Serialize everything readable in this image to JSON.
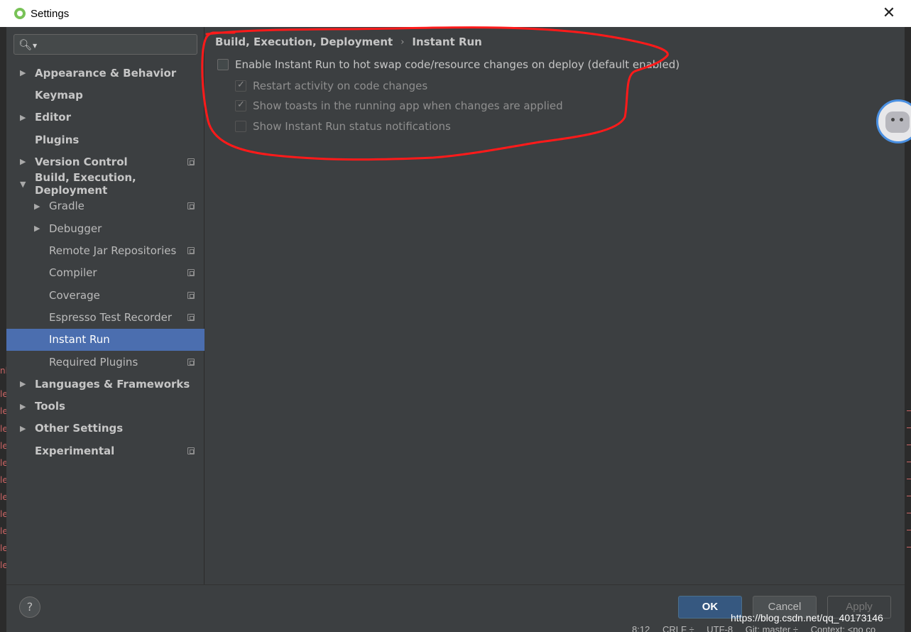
{
  "window": {
    "title": "Settings"
  },
  "search": {
    "placeholder": ""
  },
  "sidebar": {
    "items": [
      {
        "label": "Appearance & Behavior",
        "arrow": "▶"
      },
      {
        "label": "Keymap"
      },
      {
        "label": "Editor",
        "arrow": "▶"
      },
      {
        "label": "Plugins"
      },
      {
        "label": "Version Control",
        "arrow": "▶"
      },
      {
        "label": "Build, Execution, Deployment",
        "arrow": "▼"
      },
      {
        "label": "Gradle",
        "arrow": "▶"
      },
      {
        "label": "Debugger",
        "arrow": "▶"
      },
      {
        "label": "Remote Jar Repositories"
      },
      {
        "label": "Compiler"
      },
      {
        "label": "Coverage"
      },
      {
        "label": "Espresso Test Recorder"
      },
      {
        "label": "Instant Run"
      },
      {
        "label": "Required Plugins"
      },
      {
        "label": "Languages & Frameworks",
        "arrow": "▶"
      },
      {
        "label": "Tools",
        "arrow": "▶"
      },
      {
        "label": "Other Settings",
        "arrow": "▶"
      },
      {
        "label": "Experimental"
      }
    ]
  },
  "content": {
    "breadcrumb": {
      "parent": "Build, Execution, Deployment",
      "separator": "›",
      "current": "Instant Run"
    },
    "options": [
      {
        "label": "Enable Instant Run to hot swap code/resource changes on deploy (default enabled)",
        "checked": false
      },
      {
        "label": "Restart activity on code changes",
        "checked": true
      },
      {
        "label": "Show toasts in the running app when changes are applied",
        "checked": true
      },
      {
        "label": "Show Instant Run status notifications",
        "checked": false
      }
    ]
  },
  "footer": {
    "help_label": "?",
    "ok_label": "OK",
    "cancel_label": "Cancel",
    "apply_label": "Apply"
  },
  "watermark": "https://blog.csdn.net/qq_40173146",
  "statusbar": {
    "position": "8:12",
    "line_sep": "CRLF ÷",
    "encoding": "UTF-8",
    "git": "Git: master ÷",
    "context": "Context: <no co"
  },
  "colors": {
    "selection": "#4b6eaf",
    "annotation": "#ff1a1a",
    "ok_button": "#365880"
  }
}
